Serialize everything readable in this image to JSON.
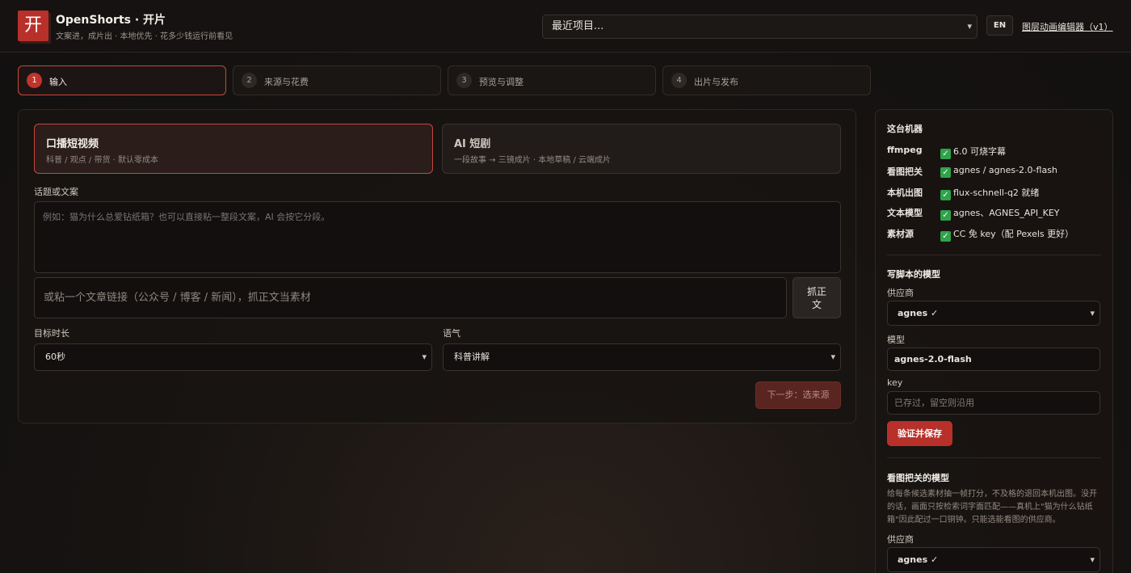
{
  "header": {
    "logo_glyph": "开",
    "title": "OpenShorts · 开片",
    "subtitle": "文案进，成片出 · 本地优先 · 花多少钱运行前看见",
    "project_select": "最近项目...",
    "lang_button": "EN",
    "editor_link": "图层动画编辑器（v1）"
  },
  "steps": [
    {
      "num": "1",
      "label": "输入"
    },
    {
      "num": "2",
      "label": "来源与花费"
    },
    {
      "num": "3",
      "label": "预览与调整"
    },
    {
      "num": "4",
      "label": "出片与发布"
    }
  ],
  "modes": [
    {
      "title": "口播短视频",
      "desc": "科普 / 观点 / 带货 · 默认零成本"
    },
    {
      "title": "AI 短剧",
      "desc": "一段故事 → 三镜成片 · 本地草稿 / 云端成片"
    }
  ],
  "form": {
    "topic_label": "话题或文案",
    "topic_placeholder": "例如：猫为什么总爱钻纸箱？也可以直接粘一整段文案，AI 会按它分段。",
    "url_placeholder": "或粘一个文章链接（公众号 / 博客 / 新闻），抓正文当素材",
    "fetch_line1": "抓正",
    "fetch_line2": "文",
    "duration_label": "目标时长",
    "duration_value": "60秒",
    "tone_label": "语气",
    "tone_value": "科普讲解",
    "next_button": "下一步：选来源"
  },
  "machine": {
    "heading": "这台机器",
    "rows": [
      {
        "key": "ffmpeg",
        "value": "6.0 可烧字幕"
      },
      {
        "key": "看图把关",
        "value": "agnes / agnes-2.0-flash"
      },
      {
        "key": "本机出图",
        "value": "flux-schnell-q2 就绪"
      },
      {
        "key": "文本模型",
        "value": "agnes、AGNES_API_KEY"
      },
      {
        "key": "素材源",
        "value": "CC 免 key（配 Pexels 更好）"
      }
    ]
  },
  "script_model": {
    "heading": "写脚本的模型",
    "provider_label": "供应商",
    "provider_value": "agnes ✓",
    "model_label": "模型",
    "model_value": "agnes-2.0-flash",
    "key_label": "key",
    "key_placeholder": "已存过，留空则沿用",
    "verify_button": "验证并保存"
  },
  "vision_model": {
    "heading": "看图把关的模型",
    "desc": "给每条候选素材抽一帧打分，不及格的退回本机出图。没开的话，画面只按检索词字面匹配——真机上\"猫为什么钻纸箱\"因此配过一口铜钟。只能选能看图的供应商。",
    "provider_label": "供应商",
    "provider_value": "agnes ✓"
  }
}
